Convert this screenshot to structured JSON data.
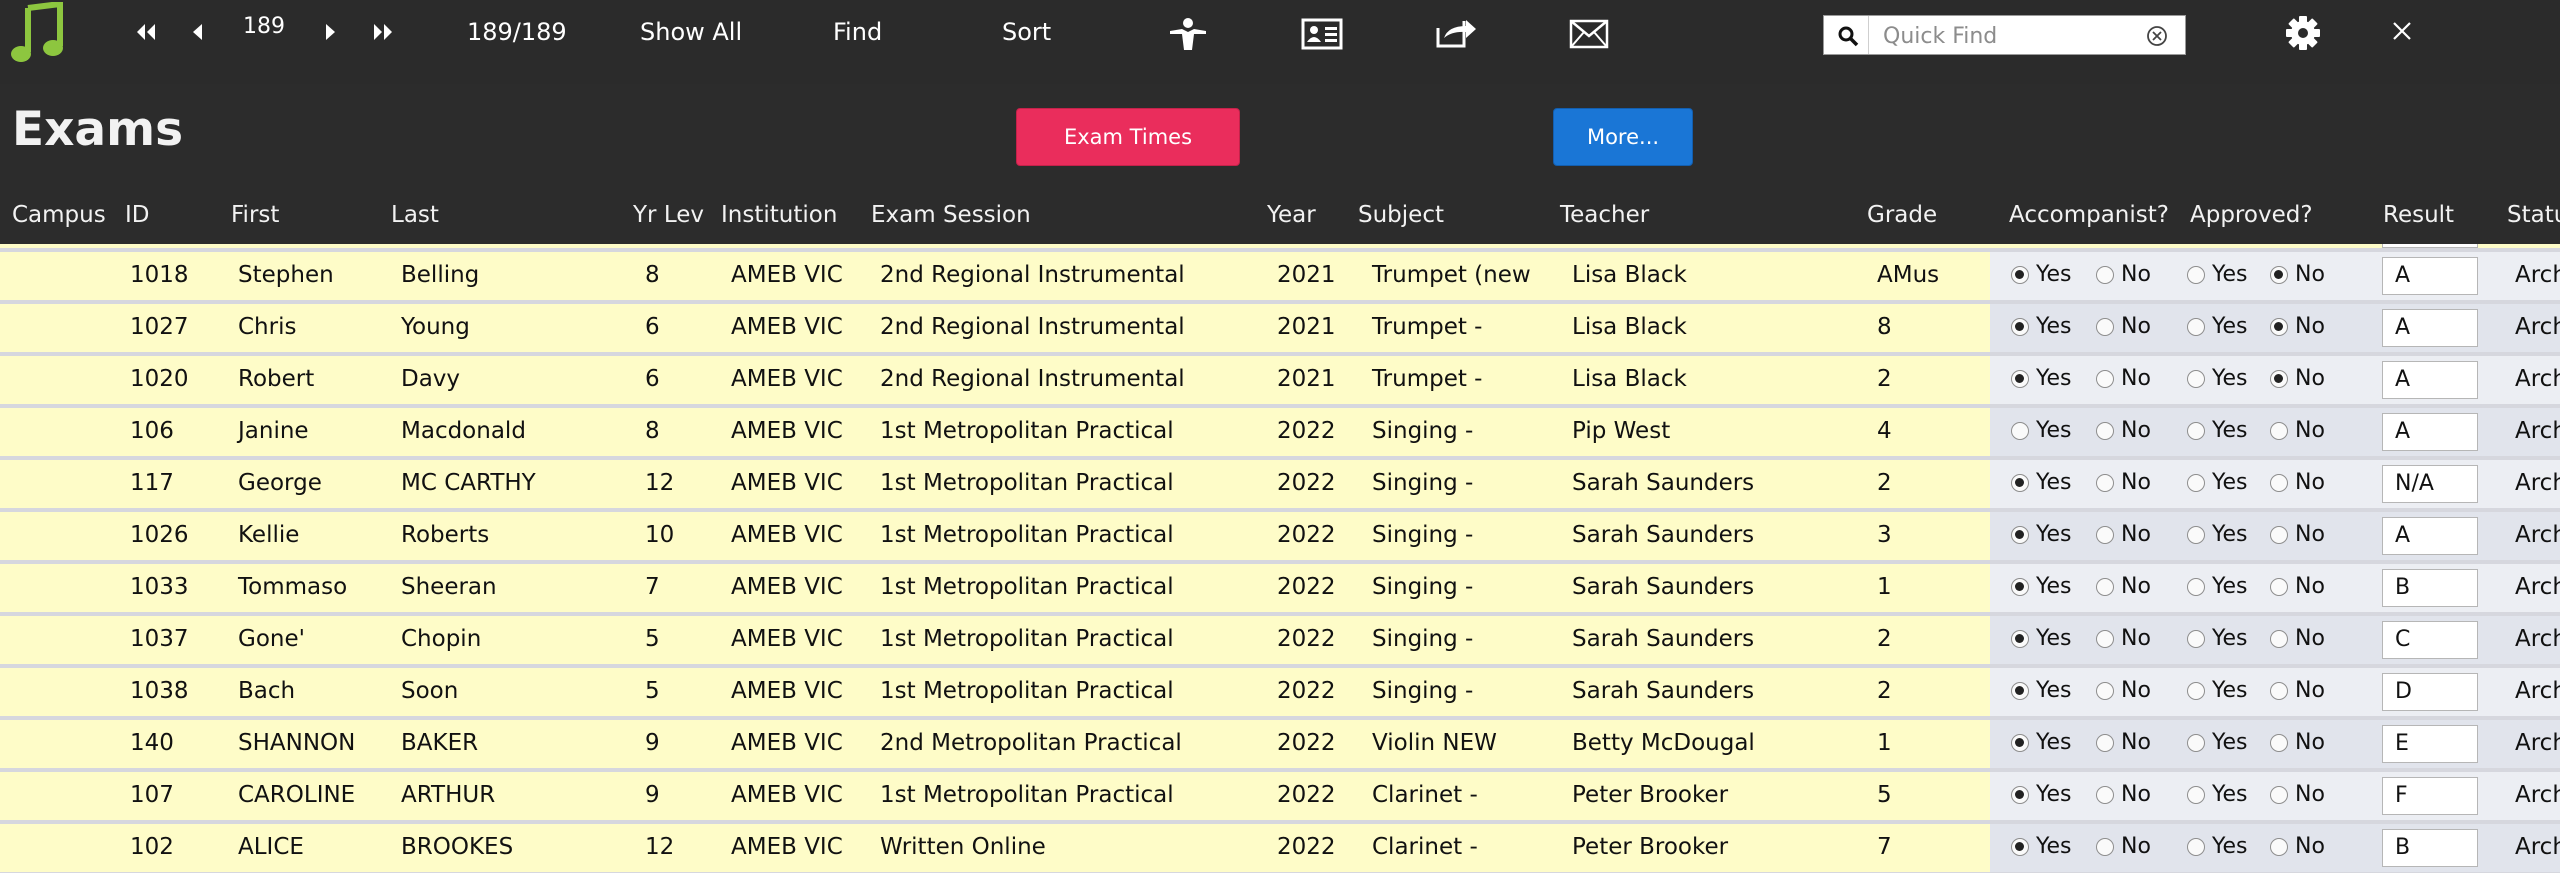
{
  "toolbar": {
    "record_number": "189",
    "record_count": "189/189",
    "show_all_label": "Show All",
    "find_label": "Find",
    "sort_label": "Sort",
    "quick_find_placeholder": "Quick Find",
    "icons": [
      "music-note-icon",
      "first-record-icon",
      "prev-record-icon",
      "next-record-icon",
      "last-record-icon",
      "person-icon",
      "contact-card-icon",
      "share-icon",
      "envelope-icon",
      "search-icon",
      "clear-icon",
      "gear-icon",
      "close-icon"
    ],
    "accent_color": "#8dc63f"
  },
  "page": {
    "title": "Exams",
    "exam_times_label": "Exam Times",
    "more_label": "More...",
    "exam_times_color": "#ea2d5c",
    "more_color": "#1a76d6"
  },
  "columns": [
    "Campus",
    "ID",
    "First",
    "Last",
    "Yr Lev",
    "Institution",
    "Exam Session",
    "Year",
    "Subject",
    "Teacher",
    "Grade",
    "Accompanist?",
    "Approved?",
    "Result",
    "Status"
  ],
  "radio_labels": {
    "yes": "Yes",
    "no": "No"
  },
  "rows": [
    {
      "campus": "",
      "id": "1018",
      "first": "Stephen",
      "last": "Belling",
      "yr": "8",
      "inst": "AMEB VIC",
      "session": "2nd Regional Instrumental",
      "year": "2021",
      "subject": "Trumpet (new",
      "teacher": "Lisa Black",
      "grade": "AMus",
      "accompanist": "yes",
      "approved": "no",
      "result": "A",
      "status": "Arch"
    },
    {
      "campus": "",
      "id": "1027",
      "first": "Chris",
      "last": "Young",
      "yr": "6",
      "inst": "AMEB VIC",
      "session": "2nd Regional Instrumental",
      "year": "2021",
      "subject": "Trumpet -",
      "teacher": "Lisa Black",
      "grade": "8",
      "accompanist": "yes",
      "approved": "no",
      "result": "A",
      "status": "Arch"
    },
    {
      "campus": "",
      "id": "1020",
      "first": "Robert",
      "last": "Davy",
      "yr": "6",
      "inst": "AMEB VIC",
      "session": "2nd Regional Instrumental",
      "year": "2021",
      "subject": "Trumpet -",
      "teacher": "Lisa Black",
      "grade": "2",
      "accompanist": "yes",
      "approved": "no",
      "result": "A",
      "status": "Arch"
    },
    {
      "campus": "",
      "id": "106",
      "first": "Janine",
      "last": "Macdonald",
      "yr": "8",
      "inst": "AMEB VIC",
      "session": "1st Metropolitan Practical",
      "year": "2022",
      "subject": "Singing -",
      "teacher": "Pip West",
      "grade": "4",
      "accompanist": "",
      "approved": "",
      "result": "A",
      "status": "Arch"
    },
    {
      "campus": "",
      "id": "117",
      "first": "George",
      "last": "MC CARTHY",
      "yr": "12",
      "inst": "AMEB VIC",
      "session": "1st Metropolitan Practical",
      "year": "2022",
      "subject": "Singing -",
      "teacher": "Sarah Saunders",
      "grade": "2",
      "accompanist": "yes",
      "approved": "",
      "result": "N/A",
      "status": "Arch"
    },
    {
      "campus": "",
      "id": "1026",
      "first": "Kellie",
      "last": "Roberts",
      "yr": "10",
      "inst": "AMEB VIC",
      "session": "1st Metropolitan Practical",
      "year": "2022",
      "subject": "Singing -",
      "teacher": "Sarah Saunders",
      "grade": "3",
      "accompanist": "yes",
      "approved": "",
      "result": "A",
      "status": "Arch"
    },
    {
      "campus": "",
      "id": "1033",
      "first": "Tommaso",
      "last": "Sheeran",
      "yr": "7",
      "inst": "AMEB VIC",
      "session": "1st Metropolitan Practical",
      "year": "2022",
      "subject": "Singing -",
      "teacher": "Sarah Saunders",
      "grade": "1",
      "accompanist": "yes",
      "approved": "",
      "result": "B",
      "status": "Arch"
    },
    {
      "campus": "",
      "id": "1037",
      "first": "Gone'",
      "last": "Chopin",
      "yr": "5",
      "inst": "AMEB VIC",
      "session": "1st Metropolitan Practical",
      "year": "2022",
      "subject": "Singing -",
      "teacher": "Sarah Saunders",
      "grade": "2",
      "accompanist": "yes",
      "approved": "",
      "result": "C",
      "status": "Arch"
    },
    {
      "campus": "",
      "id": "1038",
      "first": "Bach",
      "last": "Soon",
      "yr": "5",
      "inst": "AMEB VIC",
      "session": "1st Metropolitan Practical",
      "year": "2022",
      "subject": "Singing -",
      "teacher": "Sarah Saunders",
      "grade": "2",
      "accompanist": "yes",
      "approved": "",
      "result": "D",
      "status": "Arch"
    },
    {
      "campus": "",
      "id": "140",
      "first": "SHANNON",
      "last": "BAKER",
      "yr": "9",
      "inst": "AMEB VIC",
      "session": "2nd Metropolitan Practical",
      "year": "2022",
      "subject": "Violin NEW",
      "teacher": "Betty McDougal",
      "grade": "1",
      "accompanist": "yes",
      "approved": "",
      "result": "E",
      "status": "Arch"
    },
    {
      "campus": "",
      "id": "107",
      "first": "CAROLINE",
      "last": "ARTHUR",
      "yr": "9",
      "inst": "AMEB VIC",
      "session": "1st Metropolitan Practical",
      "year": "2022",
      "subject": "Clarinet -",
      "teacher": "Peter Brooker",
      "grade": "5",
      "accompanist": "yes",
      "approved": "",
      "result": "F",
      "status": "Arch"
    },
    {
      "campus": "",
      "id": "102",
      "first": "ALICE",
      "last": "BROOKES",
      "yr": "12",
      "inst": "AMEB VIC",
      "session": "Written Online",
      "year": "2022",
      "subject": "Clarinet -",
      "teacher": "Peter Brooker",
      "grade": "7",
      "accompanist": "yes",
      "approved": "",
      "result": "B",
      "status": "Arch"
    }
  ]
}
